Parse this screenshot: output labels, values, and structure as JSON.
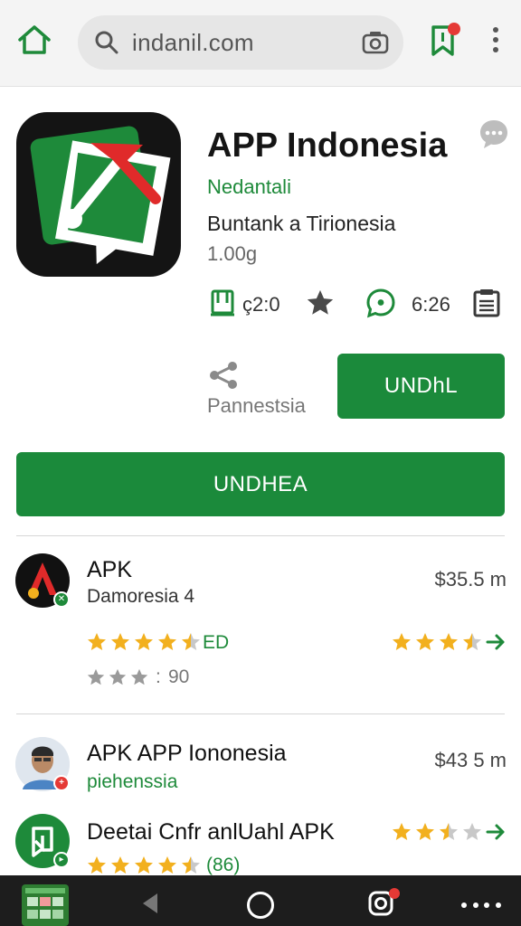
{
  "browser": {
    "url": "indanil.com"
  },
  "app": {
    "title": "APP Indonesia",
    "developer": "Nedantali",
    "category": "Buntank a Tirionesia",
    "downloads": "1.00g",
    "stats": {
      "size": "ç2:0",
      "reviews": "6:26"
    },
    "share_label": "Pannestsia",
    "install_small_label": "UNDhL",
    "install_big_label": "UNDHEA"
  },
  "list": [
    {
      "title": "APK",
      "subtitle": "Damoresia 4",
      "price": "$35.5 m",
      "rating_text": "ED",
      "rating_count": "90"
    },
    {
      "title": "APK APP Iononesia",
      "subtitle": "piehenssia",
      "price": "$43 5 m"
    },
    {
      "title": "Deetai Cnfr anlUahl APK",
      "rating_count": "(86)"
    }
  ],
  "colors": {
    "accent_green": "#1b8a3b",
    "star_yellow": "#f2b01e",
    "badge_red": "#e53935",
    "bottom_bar": "#1d1d1d"
  },
  "icons": {
    "home": "home-icon",
    "search": "search-icon",
    "camera": "camera-icon",
    "bookmark": "bookmark-icon",
    "menu": "more-vert-icon",
    "chat": "chat-bubble-icon",
    "share": "share-icon",
    "arrow": "arrow-right-icon"
  }
}
